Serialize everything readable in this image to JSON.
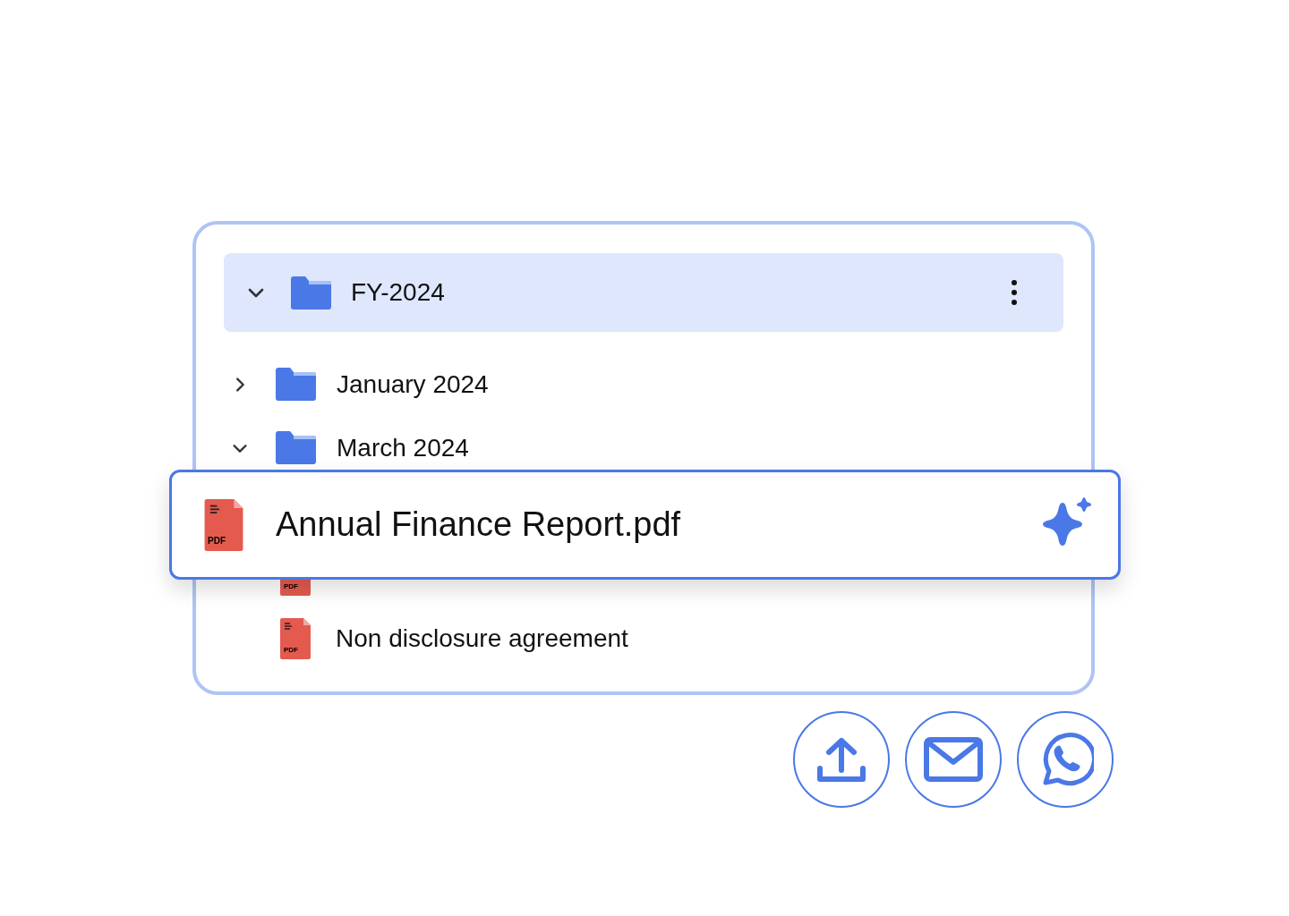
{
  "folder": {
    "name": "FY-2024",
    "expanded": true,
    "children": [
      {
        "name": "January 2024",
        "expanded": false
      },
      {
        "name": "March 2024",
        "expanded": true,
        "children": [
          {
            "badge": "PDF"
          },
          {
            "name": "Non disclosure agreement",
            "badge": "PDF"
          }
        ]
      }
    ]
  },
  "floating_file": {
    "name": "Annual Finance Report.pdf",
    "badge": "PDF"
  },
  "share_buttons": [
    {
      "kind": "upload"
    },
    {
      "kind": "email"
    },
    {
      "kind": "whatsapp"
    }
  ]
}
